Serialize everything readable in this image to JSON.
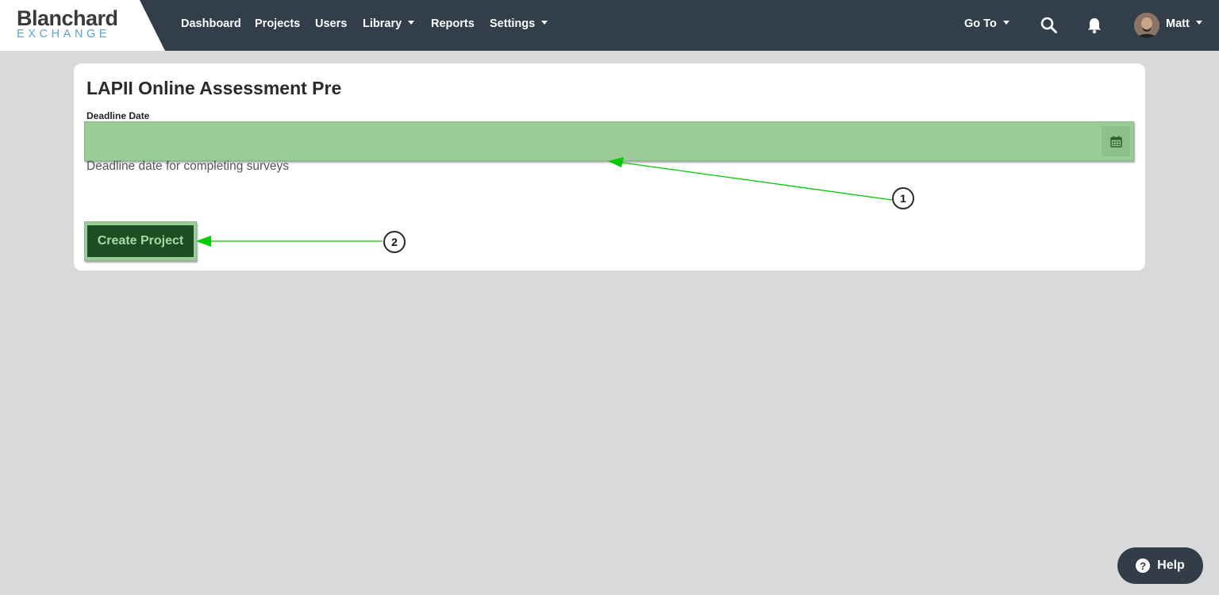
{
  "brand": {
    "name": "Blanchard",
    "sub": "EXCHANGE"
  },
  "nav": {
    "items": [
      {
        "label": "Dashboard"
      },
      {
        "label": "Projects"
      },
      {
        "label": "Users"
      },
      {
        "label": "Library",
        "dropdown": true
      },
      {
        "label": "Reports"
      },
      {
        "label": "Settings",
        "dropdown": true
      }
    ],
    "goto_label": "Go To",
    "user_name": "Matt",
    "icons": [
      "search-icon",
      "bell-icon",
      "avatar",
      "chevron-down-icon"
    ]
  },
  "form": {
    "title": "LAPII Online Assessment Pre",
    "deadline_label": "Deadline Date",
    "deadline_value": "",
    "deadline_help": "Deadline date for completing surveys",
    "submit_label": "Create Project"
  },
  "annotations": {
    "markers": [
      "1",
      "2"
    ],
    "color": "#00cc00"
  },
  "help": {
    "label": "Help",
    "icon": "?"
  },
  "colors": {
    "topbar": "#323e49",
    "highlight": "#9bcc98",
    "button_bg": "#1e4d24",
    "button_text": "#a7d9a3",
    "page_bg": "#d8d9db"
  }
}
